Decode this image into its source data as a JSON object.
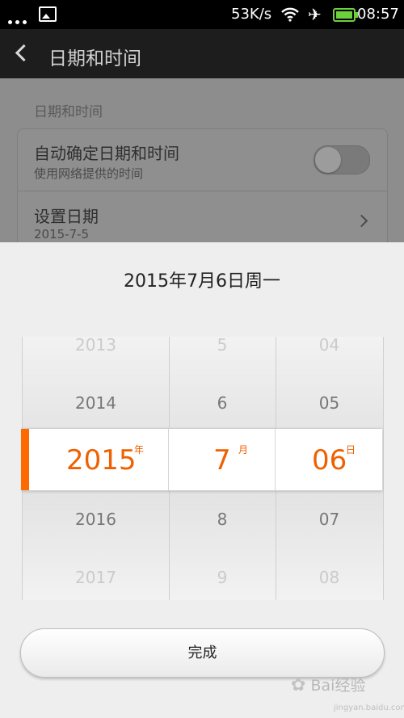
{
  "status_bar": {
    "speed": "53K/s",
    "time": "08:57",
    "icons": [
      "more-dots-icon",
      "image-notification-icon",
      "wifi-icon",
      "airplane-icon",
      "battery-icon"
    ]
  },
  "header": {
    "title": "日期和时间"
  },
  "settings": {
    "section_label": "日期和时间",
    "auto": {
      "title": "自动确定日期和时间",
      "subtitle": "使用网络提供的时间",
      "toggle_on": false
    },
    "set_date": {
      "title": "设置日期",
      "value": "2015-7-5"
    }
  },
  "dialog": {
    "title": "2015年7月6日周一",
    "picker": {
      "year": {
        "items": [
          "2013",
          "2014",
          "2015",
          "2016",
          "2017"
        ],
        "selected": "2015",
        "unit": "年"
      },
      "month": {
        "items": [
          "5",
          "6",
          "7",
          "8",
          "9"
        ],
        "selected": "7",
        "unit": "月"
      },
      "day": {
        "items": [
          "04",
          "05",
          "06",
          "07",
          "08"
        ],
        "selected": "06",
        "unit": "日"
      }
    },
    "done_label": "完成"
  },
  "watermark": {
    "text": "Bai经验",
    "url": "jingyan.baidu.com"
  },
  "colors": {
    "accent": "#ef6100",
    "dim_overlay": "#8d8d8d"
  }
}
